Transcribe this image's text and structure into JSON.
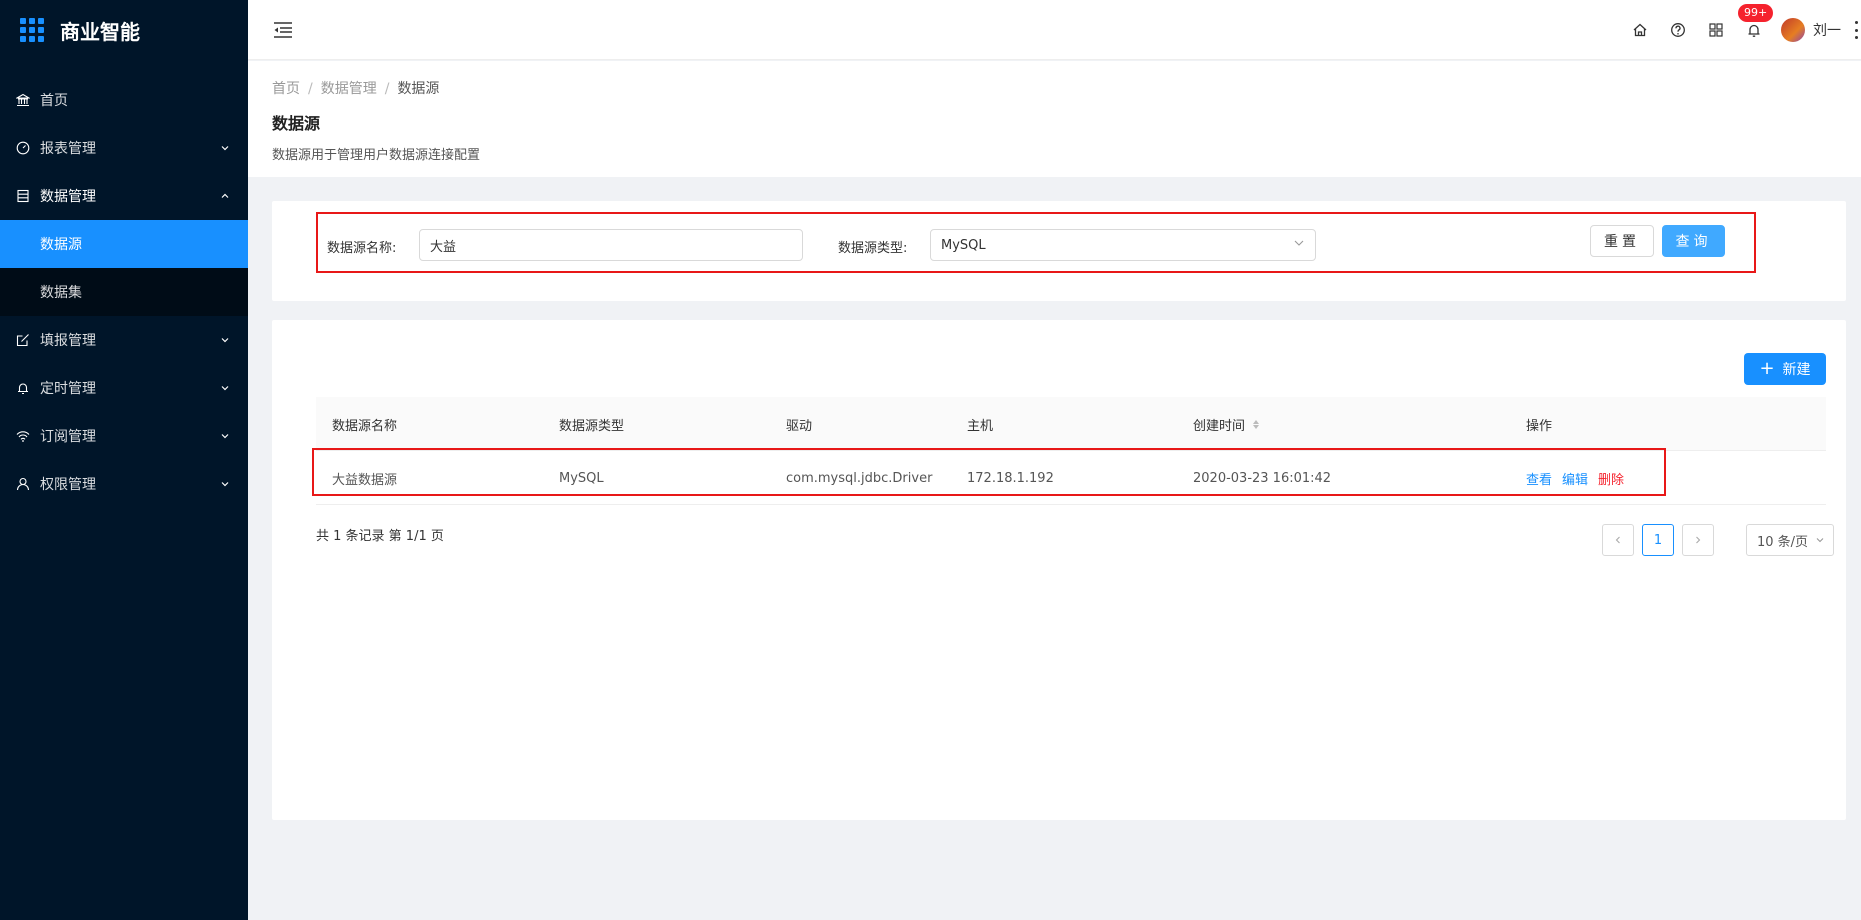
{
  "brand": {
    "title": "商业智能"
  },
  "sidebar": {
    "items": [
      {
        "label": "首页"
      },
      {
        "label": "报表管理"
      },
      {
        "label": "数据管理"
      },
      {
        "label": "填报管理"
      },
      {
        "label": "定时管理"
      },
      {
        "label": "订阅管理"
      },
      {
        "label": "权限管理"
      }
    ],
    "submenu": [
      {
        "label": "数据源"
      },
      {
        "label": "数据集"
      }
    ]
  },
  "header": {
    "badge": "99+",
    "user_name": "刘一"
  },
  "breadcrumb": [
    "首页",
    "数据管理",
    "数据源"
  ],
  "page": {
    "title": "数据源",
    "description": "数据源用于管理用户数据源连接配置"
  },
  "search": {
    "name_label": "数据源名称:",
    "name_value": "大益",
    "type_label": "数据源类型:",
    "type_value": "MySQL",
    "reset_label": "重置",
    "query_label": "查询"
  },
  "toolbar": {
    "new_label": "新建"
  },
  "table": {
    "columns": [
      "数据源名称",
      "数据源类型",
      "驱动",
      "主机",
      "创建时间",
      "操作"
    ],
    "rows": [
      {
        "name": "大益数据源",
        "type": "MySQL",
        "driver": "com.mysql.jdbc.Driver",
        "host": "172.18.1.192",
        "created": "2020-03-23 16:01:42"
      }
    ],
    "actions": {
      "view": "查看",
      "edit": "编辑",
      "delete": "删除"
    }
  },
  "pagination": {
    "summary": "共 1 条记录 第 1/1 页",
    "current_page": "1",
    "page_size": "10 条/页"
  },
  "colors": {
    "sidebar_bg": "#001529",
    "primary": "#1890ff",
    "danger": "#f5222d",
    "highlight_box": "#e81818"
  }
}
